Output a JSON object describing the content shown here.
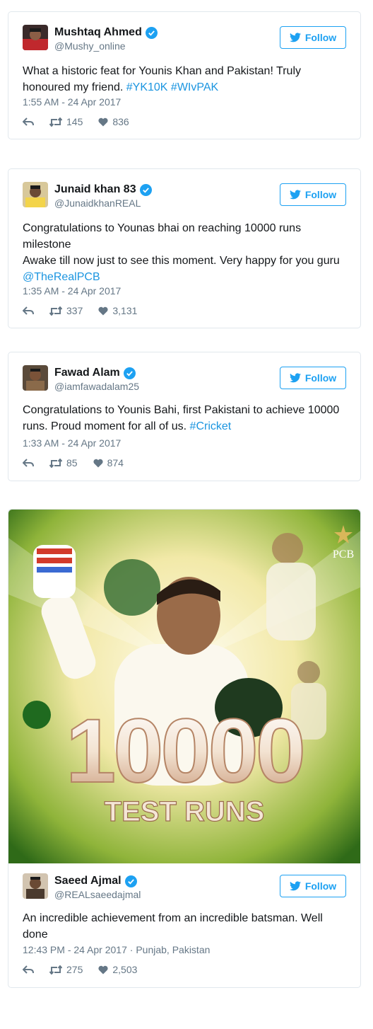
{
  "follow_label": "Follow",
  "tweets": [
    {
      "name": "Mushtaq Ahmed",
      "handle": "@Mushy_online",
      "text_plain": "What a historic feat for Younis Khan and Pakistan! Truly honoured my friend. ",
      "hashtags": [
        "#YK10K",
        "#WIvPAK"
      ],
      "timestamp": "1:55 AM - 24 Apr 2017",
      "retweets": "145",
      "likes": "836"
    },
    {
      "name": "Junaid khan 83",
      "handle": "@JunaidkhanREAL",
      "line1": "Congratulations to Younas bhai on reaching 10000 runs milestone",
      "line2": "Awake till now just to see this moment. Very happy for you guru",
      "mention": "@TheRealPCB",
      "timestamp": "1:35 AM - 24 Apr 2017",
      "retweets": "337",
      "likes": "3,131"
    },
    {
      "name": "Fawad Alam",
      "handle": "@iamfawadalam25",
      "text_plain": "Congratulations to Younis Bahi, first Pakistani to achieve 10000 runs. Proud moment for all of us. ",
      "hashtag": "#Cricket",
      "timestamp": "1:33 AM - 24 Apr 2017",
      "retweets": "85",
      "likes": "874"
    },
    {
      "name": "Saeed Ajmal",
      "handle": "@REALsaeedajmal",
      "text_plain": "An incredible achievement from an incredible batsman. Well done",
      "timestamp": "12:43 PM - 24 Apr 2017 · Punjab, Pakistan",
      "retweets": "275",
      "likes": "2,503",
      "media": {
        "big_number": "10000",
        "caption": "TEST RUNS",
        "logo_text": "PCB"
      }
    }
  ],
  "colors": {
    "accent": "#1da1f2",
    "link": "#1b95e0",
    "muted": "#657786",
    "border": "#e1e8ed"
  },
  "icons": [
    "reply-icon",
    "retweet-icon",
    "heart-icon",
    "verified-icon",
    "twitter-bird-icon"
  ]
}
